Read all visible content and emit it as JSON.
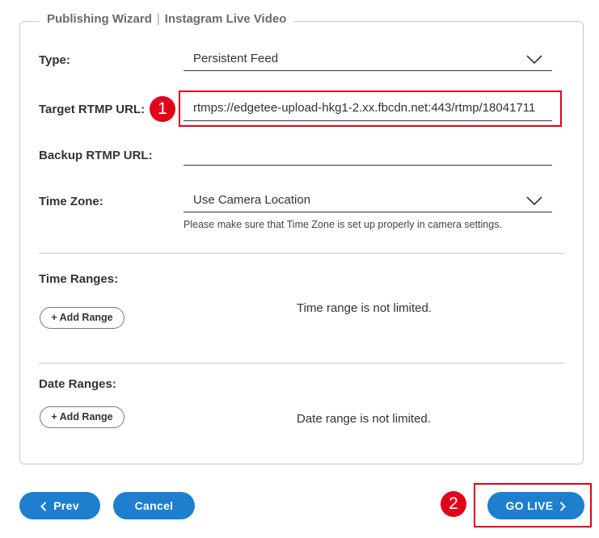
{
  "wizard": {
    "title": "Publishing Wizard",
    "separator": "|",
    "subtitle": "Instagram Live Video"
  },
  "form": {
    "type": {
      "label": "Type:",
      "value": "Persistent Feed"
    },
    "target_rtmp": {
      "label": "Target RTMP URL:",
      "value": "rtmps://edgetee-upload-hkg1-2.xx.fbcdn.net:443/rtmp/18041711"
    },
    "backup_rtmp": {
      "label": "Backup RTMP URL:",
      "value": ""
    },
    "time_zone": {
      "label": "Time Zone:",
      "value": "Use Camera Location",
      "hint": "Please make sure that Time Zone is set up properly in camera settings."
    },
    "time_ranges": {
      "label": "Time Ranges:",
      "add_label": "+ Add Range",
      "status": "Time range is not limited."
    },
    "date_ranges": {
      "label": "Date Ranges:",
      "add_label": "+ Add Range",
      "status": "Date range is not limited."
    }
  },
  "footer": {
    "prev_label": "Prev",
    "cancel_label": "Cancel",
    "go_live_label": "GO LIVE"
  },
  "annotations": {
    "step1": "1",
    "step2": "2",
    "color": "#e2001a"
  },
  "colors": {
    "primary_button": "#1e7fcf"
  },
  "icons": {
    "dropdown": "chevron-down-icon",
    "prev": "chevron-left-icon",
    "go_live": "chevron-right-icon"
  }
}
